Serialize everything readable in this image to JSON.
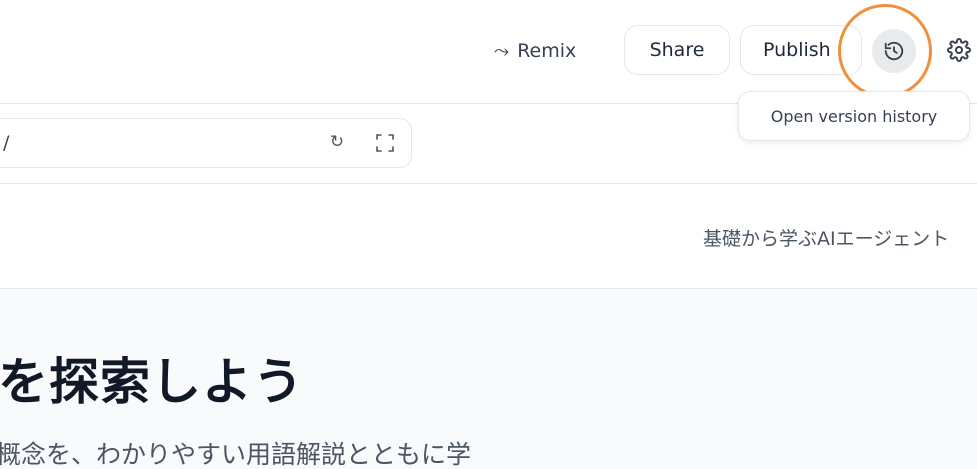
{
  "toolbar": {
    "remix_label": "Remix",
    "share_label": "Share",
    "publish_label": "Publish",
    "history_tooltip": "Open version history"
  },
  "urlbar": {
    "url_text": "/"
  },
  "app": {
    "title": "基礎から学ぶAIエージェント"
  },
  "hero": {
    "title": "を探索しよう",
    "subtitle": "概念を、わかりやすい用語解説とともに学"
  },
  "icons": {
    "remix": "remix-icon",
    "history": "history-icon",
    "settings": "gear-icon",
    "reload": "reload-icon",
    "fullscreen": "fullscreen-icon"
  },
  "colors": {
    "highlight_ring": "#f0903a",
    "history_button_bg": "#e9eaec"
  }
}
